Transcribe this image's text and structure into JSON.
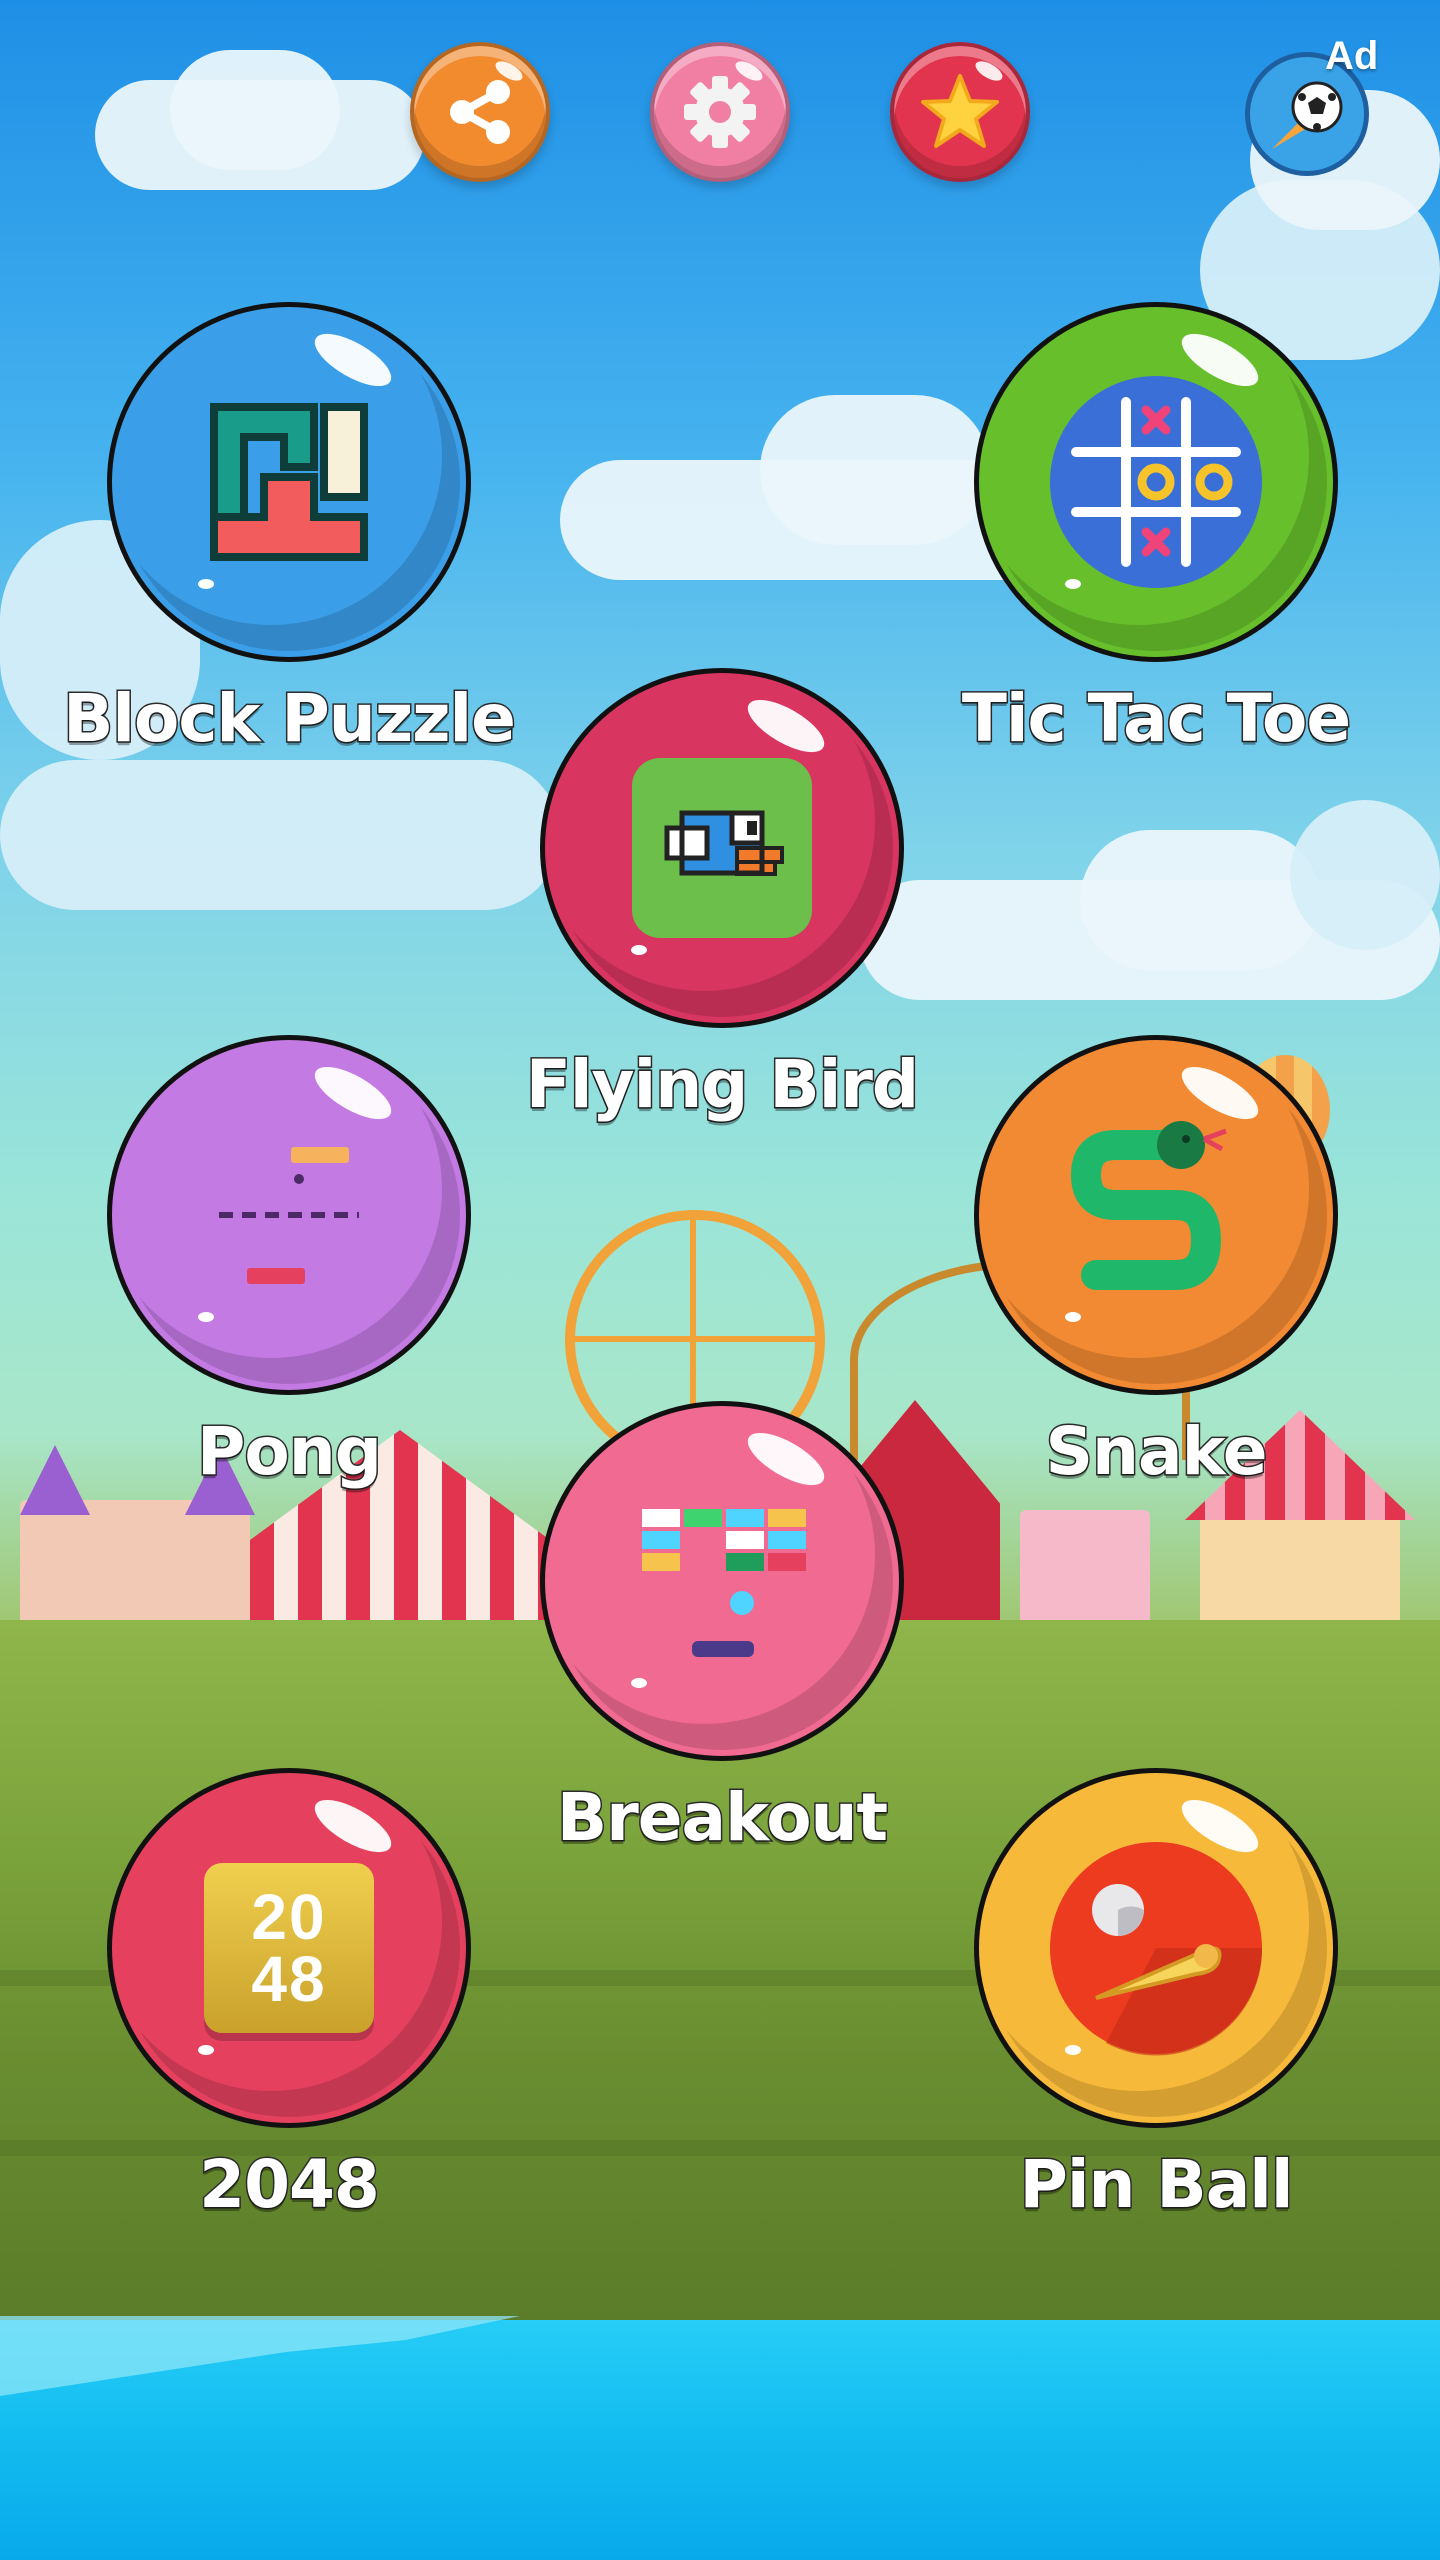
{
  "topbar": {
    "share_icon": "share-icon",
    "settings_icon": "gear-icon",
    "rate_icon": "star-icon",
    "ad_icon": "soccer-ball-icon",
    "ad_label": "Ad"
  },
  "games": [
    {
      "label": "Block Puzzle",
      "icon": "block-puzzle-icon",
      "color": "#3a9ee8"
    },
    {
      "label": "Tic Tac Toe",
      "icon": "tic-tac-toe-icon",
      "color": "#67bf2c"
    },
    {
      "label": "Flying Bird",
      "icon": "flying-bird-icon",
      "color": "#d83561"
    },
    {
      "label": "Pong",
      "icon": "pong-icon",
      "color": "#c37ae3"
    },
    {
      "label": "Snake",
      "icon": "snake-icon",
      "color": "#f28a33"
    },
    {
      "label": "Breakout",
      "icon": "breakout-icon",
      "color": "#f06a92"
    },
    {
      "label": "2048",
      "icon": "tile-2048-icon",
      "color": "#e5415f",
      "tile_top": "20",
      "tile_bottom": "48"
    },
    {
      "label": "Pin Ball",
      "icon": "pinball-icon",
      "color": "#f7b93a"
    }
  ]
}
